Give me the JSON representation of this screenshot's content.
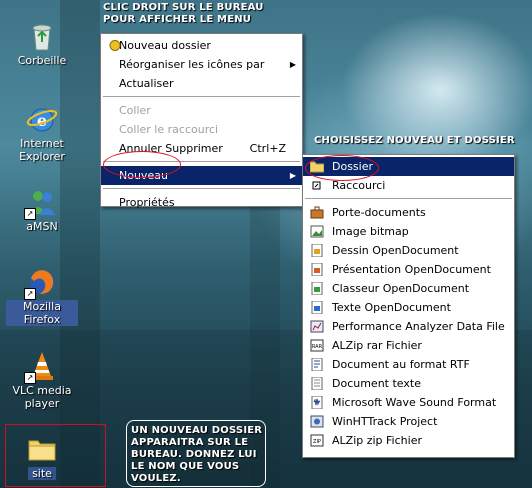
{
  "desktop": {
    "icons": [
      {
        "label": "Corbeille"
      },
      {
        "label": "Internet Explorer"
      },
      {
        "label": "aMSN"
      },
      {
        "label": "Mozilla Firefox"
      },
      {
        "label": "VLC media player"
      },
      {
        "label": "site"
      }
    ]
  },
  "annotations": {
    "top": "CLIC DROIT SUR LE BUREAU POUR AFFICHER LE MENU",
    "right": "CHOISISSEZ NOUVEAU ET DOSSIER",
    "bottom": "UN NOUVEAU DOSSIER APPARAITRA SUR LE BUREAU. DONNEZ LUI LE NOM QUE VOUS VOULEZ."
  },
  "context_menu": {
    "items": [
      {
        "label": "Nouveau dossier"
      },
      {
        "label": "Réorganiser les icônes par"
      },
      {
        "label": "Actualiser"
      },
      {
        "label": "Coller"
      },
      {
        "label": "Coller le raccourci"
      },
      {
        "label": "Annuler Supprimer",
        "accel": "Ctrl+Z"
      },
      {
        "label": "Nouveau"
      },
      {
        "label": "Propriétés"
      }
    ]
  },
  "submenu": {
    "items": [
      {
        "label": "Dossier"
      },
      {
        "label": "Raccourci"
      },
      {
        "label": "Porte-documents"
      },
      {
        "label": "Image bitmap"
      },
      {
        "label": "Dessin OpenDocument"
      },
      {
        "label": "Présentation OpenDocument"
      },
      {
        "label": "Classeur OpenDocument"
      },
      {
        "label": "Texte OpenDocument"
      },
      {
        "label": "Performance Analyzer Data File"
      },
      {
        "label": "ALZip rar Fichier"
      },
      {
        "label": "Document au format RTF"
      },
      {
        "label": "Document texte"
      },
      {
        "label": "Microsoft Wave Sound Format"
      },
      {
        "label": "WinHTTrack Project"
      },
      {
        "label": "ALZip zip Fichier"
      }
    ]
  },
  "colors": {
    "selection": "#0a246a",
    "highlight_ellipse": "#e01020"
  }
}
